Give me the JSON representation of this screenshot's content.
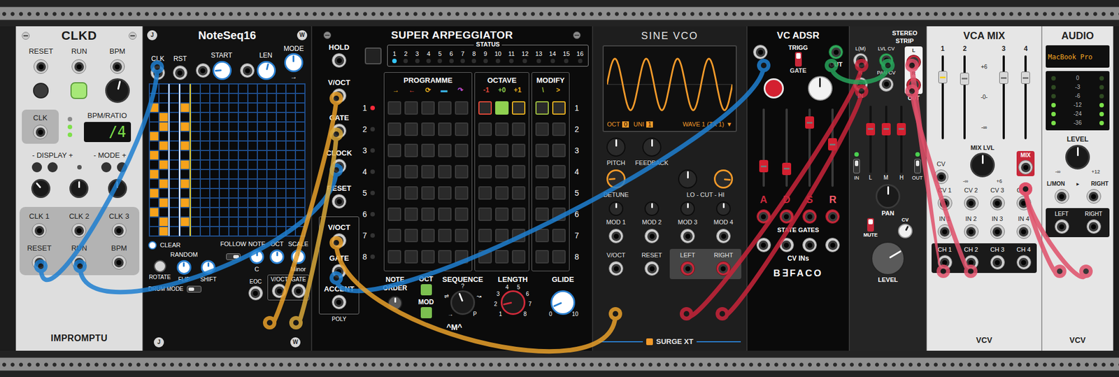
{
  "clkd": {
    "title": "CLKD",
    "top_labels": [
      "RESET",
      "RUN",
      "BPM"
    ],
    "reset_button": {
      "lit": false
    },
    "run_button": {
      "lit": true
    },
    "bpm_knob": {
      "level": 0.55
    },
    "clk_label": "CLK",
    "ratio_leds": [
      false,
      true,
      true
    ],
    "display_label": "BPM/RATIO",
    "display_value": "/4",
    "display_control": "- DISPLAY +",
    "mode_control": "- MODE +",
    "mode_led": false,
    "knobs": [
      {
        "level": 0.35
      },
      {
        "level": 0.5
      },
      {
        "level": 0.5
      }
    ],
    "clock_outputs": [
      "CLK 1",
      "CLK 2",
      "CLK 3"
    ],
    "bottom_labels": [
      "RESET",
      "RUN",
      "BPM"
    ],
    "logo": "IMPROMPTU"
  },
  "noteseq": {
    "badges": [
      "J",
      "W"
    ],
    "title": "NoteSeq16",
    "inputs": [
      {
        "label": "CLK"
      },
      {
        "label": "RST"
      }
    ],
    "start": {
      "label": "START",
      "level": 0.15
    },
    "len": {
      "label": "LEN",
      "level": 0.55
    },
    "mode": {
      "label": "MODE",
      "level": 0.5,
      "value": "→"
    },
    "grid": {
      "columns": 16,
      "rows": 16,
      "playhead_column": 2,
      "cursor_column": 3,
      "active": [
        [
          0,
          2
        ],
        [
          0,
          5
        ],
        [
          0,
          7
        ],
        [
          0,
          9
        ],
        [
          0,
          11
        ],
        [
          0,
          13
        ],
        [
          1,
          3
        ],
        [
          1,
          4
        ],
        [
          1,
          6
        ],
        [
          1,
          8
        ],
        [
          1,
          10
        ],
        [
          1,
          12
        ],
        [
          1,
          14
        ],
        [
          1,
          15
        ],
        [
          3,
          2
        ],
        [
          3,
          4
        ],
        [
          3,
          6
        ],
        [
          3,
          8
        ],
        [
          3,
          10
        ],
        [
          3,
          12
        ],
        [
          3,
          14
        ]
      ]
    },
    "clear": {
      "label": "CLEAR",
      "selected": false
    },
    "follow": {
      "label": "FOLLOW",
      "on": true
    },
    "random": {
      "label": "RANDOM"
    },
    "edit_controls": [
      {
        "label": "ROTATE",
        "level": 0.5
      },
      {
        "label": "FLIP",
        "level": 0.5
      },
      {
        "label": "SHIFT",
        "level": 0.5
      }
    ],
    "note": {
      "label": "NOTE",
      "level": 0.5,
      "value": "C"
    },
    "oct": {
      "label": "OCT",
      "level": 0.5
    },
    "scale": {
      "label": "SCALE",
      "level": 0.5,
      "value": "Minor"
    },
    "drum_mode": {
      "label": "DRUM MODE",
      "on": false
    },
    "outputs": [
      "V/OCT",
      "GATE"
    ],
    "eoc": "EOC",
    "bottom_badges": [
      "J",
      "W"
    ]
  },
  "arp": {
    "title": "SUPER ARPEGGIATOR",
    "hold": {
      "label": "HOLD",
      "on": false
    },
    "inputs": [
      "V/OCT",
      "GATE",
      "CLOCK",
      "RESET"
    ],
    "outputs": [
      "V/OCT",
      "GATE",
      "ACCENT"
    ],
    "poly": "POLY",
    "status_label": "STATUS",
    "status": [
      {
        "label": "1",
        "on": true
      },
      {
        "label": "2",
        "on": false
      },
      {
        "label": "3",
        "on": false
      },
      {
        "label": "4",
        "on": false
      },
      {
        "label": "5",
        "on": false
      },
      {
        "label": "6",
        "on": false
      },
      {
        "label": "7",
        "on": false
      },
      {
        "label": "8",
        "on": false
      },
      {
        "label": "9",
        "on": false
      },
      {
        "label": "10",
        "on": false
      },
      {
        "label": "11",
        "on": false
      },
      {
        "label": "12",
        "on": false
      },
      {
        "label": "13",
        "on": false
      },
      {
        "label": "14",
        "on": false
      },
      {
        "label": "15",
        "on": false
      },
      {
        "label": "16",
        "on": false
      }
    ],
    "programme": {
      "label": "PROGRAMME",
      "headers": [
        {
          "label": "→",
          "color": "#e8b020"
        },
        {
          "label": "←",
          "color": "#e84a3a"
        },
        {
          "label": "⟳",
          "color": "#e8b020"
        },
        {
          "label": "▬",
          "color": "#3ab0e0"
        },
        {
          "label": "↷",
          "color": "#c050d0"
        }
      ]
    },
    "octave": {
      "label": "OCTAVE",
      "headers": [
        {
          "label": "-1",
          "color": "#e84a3a"
        },
        {
          "label": "+0",
          "color": "#8fd050"
        },
        {
          "label": "+1",
          "color": "#e8b020"
        }
      ]
    },
    "modify": {
      "label": "MODIFY",
      "headers": [
        {
          "label": "\\",
          "color": "#a0c040"
        },
        {
          "label": ">",
          "color": "#e8b020"
        }
      ]
    },
    "rows": [
      {
        "label": "1",
        "active": true,
        "enabled": true,
        "programme": [
          false,
          false,
          false,
          false,
          false
        ],
        "octave": [
          false,
          true,
          false
        ],
        "modify": [
          false,
          false
        ]
      },
      {
        "label": "2",
        "active": false,
        "enabled": false,
        "programme": [
          false,
          false,
          false,
          false,
          false
        ],
        "octave": [
          false,
          false,
          false
        ],
        "modify": [
          false,
          false
        ]
      },
      {
        "label": "3",
        "active": false,
        "enabled": false,
        "programme": [
          false,
          false,
          false,
          false,
          false
        ],
        "octave": [
          false,
          false,
          false
        ],
        "modify": [
          false,
          false
        ]
      },
      {
        "label": "4",
        "active": false,
        "enabled": false,
        "programme": [
          false,
          false,
          false,
          false,
          false
        ],
        "octave": [
          false,
          false,
          false
        ],
        "modify": [
          false,
          false
        ]
      },
      {
        "label": "5",
        "active": false,
        "enabled": false,
        "programme": [
          false,
          false,
          false,
          false,
          false
        ],
        "octave": [
          false,
          false,
          false
        ],
        "modify": [
          false,
          false
        ]
      },
      {
        "label": "6",
        "active": false,
        "enabled": false,
        "programme": [
          false,
          false,
          false,
          false,
          false
        ],
        "octave": [
          false,
          false,
          false
        ],
        "modify": [
          false,
          false
        ]
      },
      {
        "label": "7",
        "active": false,
        "enabled": false,
        "programme": [
          false,
          false,
          false,
          false,
          false
        ],
        "octave": [
          false,
          false,
          false
        ],
        "modify": [
          false,
          false
        ]
      },
      {
        "label": "8",
        "active": false,
        "enabled": false,
        "programme": [
          false,
          false,
          false,
          false,
          false
        ],
        "octave": [
          false,
          false,
          false
        ],
        "modify": [
          false,
          false
        ]
      }
    ],
    "note_order": {
      "label": "NOTE ORDER",
      "level": 0.5
    },
    "oct": {
      "label": "OCT",
      "on": true
    },
    "mod": {
      "label": "MOD",
      "on": true
    },
    "sequence": {
      "label": "SEQUENCE",
      "level": 0.42,
      "marks": [
        "→",
        "⇌",
        "?",
        "↝",
        "P"
      ]
    },
    "length": {
      "label": "LENGTH",
      "level": 0.12,
      "marks": [
        "1",
        "2",
        "3",
        "4",
        "5",
        "6",
        "7",
        "8"
      ]
    },
    "glide": {
      "label": "GLIDE",
      "level": 0.08,
      "marks": [
        "0",
        "10"
      ]
    },
    "logo": "^M^"
  },
  "vco": {
    "title": "SINE VCO",
    "display": {
      "oct_label": "OCT",
      "oct": "0",
      "uni_label": "UNI",
      "uni": "1",
      "wave": "WAVE 1 (TX 1)",
      "menu": "▼",
      "cycles": 4
    },
    "pitch": {
      "label": "PITCH",
      "level": 0.5
    },
    "feedback": {
      "label": "FEEDBACK",
      "level": 0.5
    },
    "detune": {
      "label": "DETUNE",
      "level": 0.15
    },
    "filter": {
      "label": "LO - CUT - HI",
      "levels": [
        0.5,
        0.85
      ]
    },
    "mod_depths": [
      0.5,
      0.5,
      0.5,
      0.5
    ],
    "mods": [
      "MOD 1",
      "MOD 2",
      "MOD 3",
      "MOD 4"
    ],
    "inputs": [
      "V/OCT",
      "RESET"
    ],
    "outputs": [
      "LEFT",
      "RIGHT"
    ],
    "logo": "SURGE XT"
  },
  "adsr": {
    "title": "VC ADSR",
    "switch": [
      {
        "label": "TRIGG",
        "selected": true
      },
      {
        "label": "GATE",
        "selected": false
      }
    ],
    "out": "OUT",
    "shape": {
      "level": 0.5
    },
    "stages": [
      {
        "label": "A",
        "level": 0.22,
        "lit": false
      },
      {
        "label": "D",
        "level": 0.18,
        "lit": false
      },
      {
        "label": "S",
        "level": 0.88,
        "lit": false
      },
      {
        "label": "R",
        "level": 0.55,
        "lit": true
      }
    ],
    "state_gates": "STATE GATES",
    "cv_ins": "CV INs",
    "logo": "B∃FACO"
  },
  "strip": {
    "title": "STEREO STRIP",
    "inputs": [
      "L(M)",
      "R"
    ],
    "in_label": "IN",
    "cv_inputs": [
      "LVL CV",
      "PAN CV"
    ],
    "outputs": [
      "L",
      "R"
    ],
    "out_label": "OUT",
    "eq": [
      {
        "label": "L",
        "level": 0.68
      },
      {
        "label": "M",
        "level": 0.68
      },
      {
        "label": "H",
        "level": 0.68
      }
    ],
    "eq_in": {
      "label": "IN",
      "on": true
    },
    "eq_out": {
      "label": "OUT",
      "on": true
    },
    "pan": {
      "label": "PAN",
      "level": 0.5
    },
    "mute": {
      "label": "MUTE",
      "on": false
    },
    "pan_cv": {
      "label": "CV",
      "level": 0.6
    },
    "level": {
      "label": "LEVEL",
      "level": 0.72
    }
  },
  "vcamix": {
    "title": "VCA MIX",
    "channels": [
      {
        "label": "1",
        "level": 0.78,
        "lit": true
      },
      {
        "label": "2",
        "level": 0.76,
        "lit": false
      },
      {
        "label": "3",
        "level": 0.77,
        "lit": false
      },
      {
        "label": "4",
        "level": 0.77,
        "lit": false
      }
    ],
    "scale": [
      "+6",
      "-0-",
      "-∞"
    ],
    "cv": "CV",
    "mix_level": {
      "label": "MIX LVL",
      "level": 0.5,
      "min": "-∞",
      "max": "+6"
    },
    "mix": "MIX",
    "cv_inputs": [
      "CV 1",
      "CV 2",
      "CV 3",
      "CV 4"
    ],
    "inputs": [
      "IN 1",
      "IN 2",
      "IN 3",
      "IN 4"
    ],
    "channel_outputs": [
      "CH 1",
      "CH 2",
      "CH 3",
      "CH 4"
    ],
    "logo": "VCV"
  },
  "audio": {
    "title": "AUDIO",
    "device": "MacBook Pro",
    "meter": [
      {
        "label": "0",
        "on": false
      },
      {
        "label": "-3",
        "on": false
      },
      {
        "label": "-6",
        "on": false
      },
      {
        "label": "-12",
        "on": true
      },
      {
        "label": "-24",
        "on": true
      },
      {
        "label": "-36",
        "on": true
      }
    ],
    "level": {
      "label": "LEVEL",
      "level": 0.5,
      "min": "-∞",
      "max": "+12"
    },
    "inputs": [
      "L/MON",
      "RIGHT"
    ],
    "input_arrow": "▸",
    "outputs": [
      "LEFT",
      "RIGHT"
    ],
    "logo": "VCV"
  },
  "cables": [
    {
      "color": "#1f7fd0"
    },
    {
      "color": "#1f7fd0"
    },
    {
      "color": "#1f7fd0"
    },
    {
      "color": "#e8a02a"
    },
    {
      "color": "#d8a83a"
    },
    {
      "color": "#e8a02a"
    },
    {
      "color": "#c8243a"
    },
    {
      "color": "#c8243a"
    },
    {
      "color": "#27a35a"
    },
    {
      "color": "#e0506a"
    },
    {
      "color": "#e0506a"
    },
    {
      "color": "#e0506a"
    },
    {
      "color": "#e0506a"
    }
  ]
}
